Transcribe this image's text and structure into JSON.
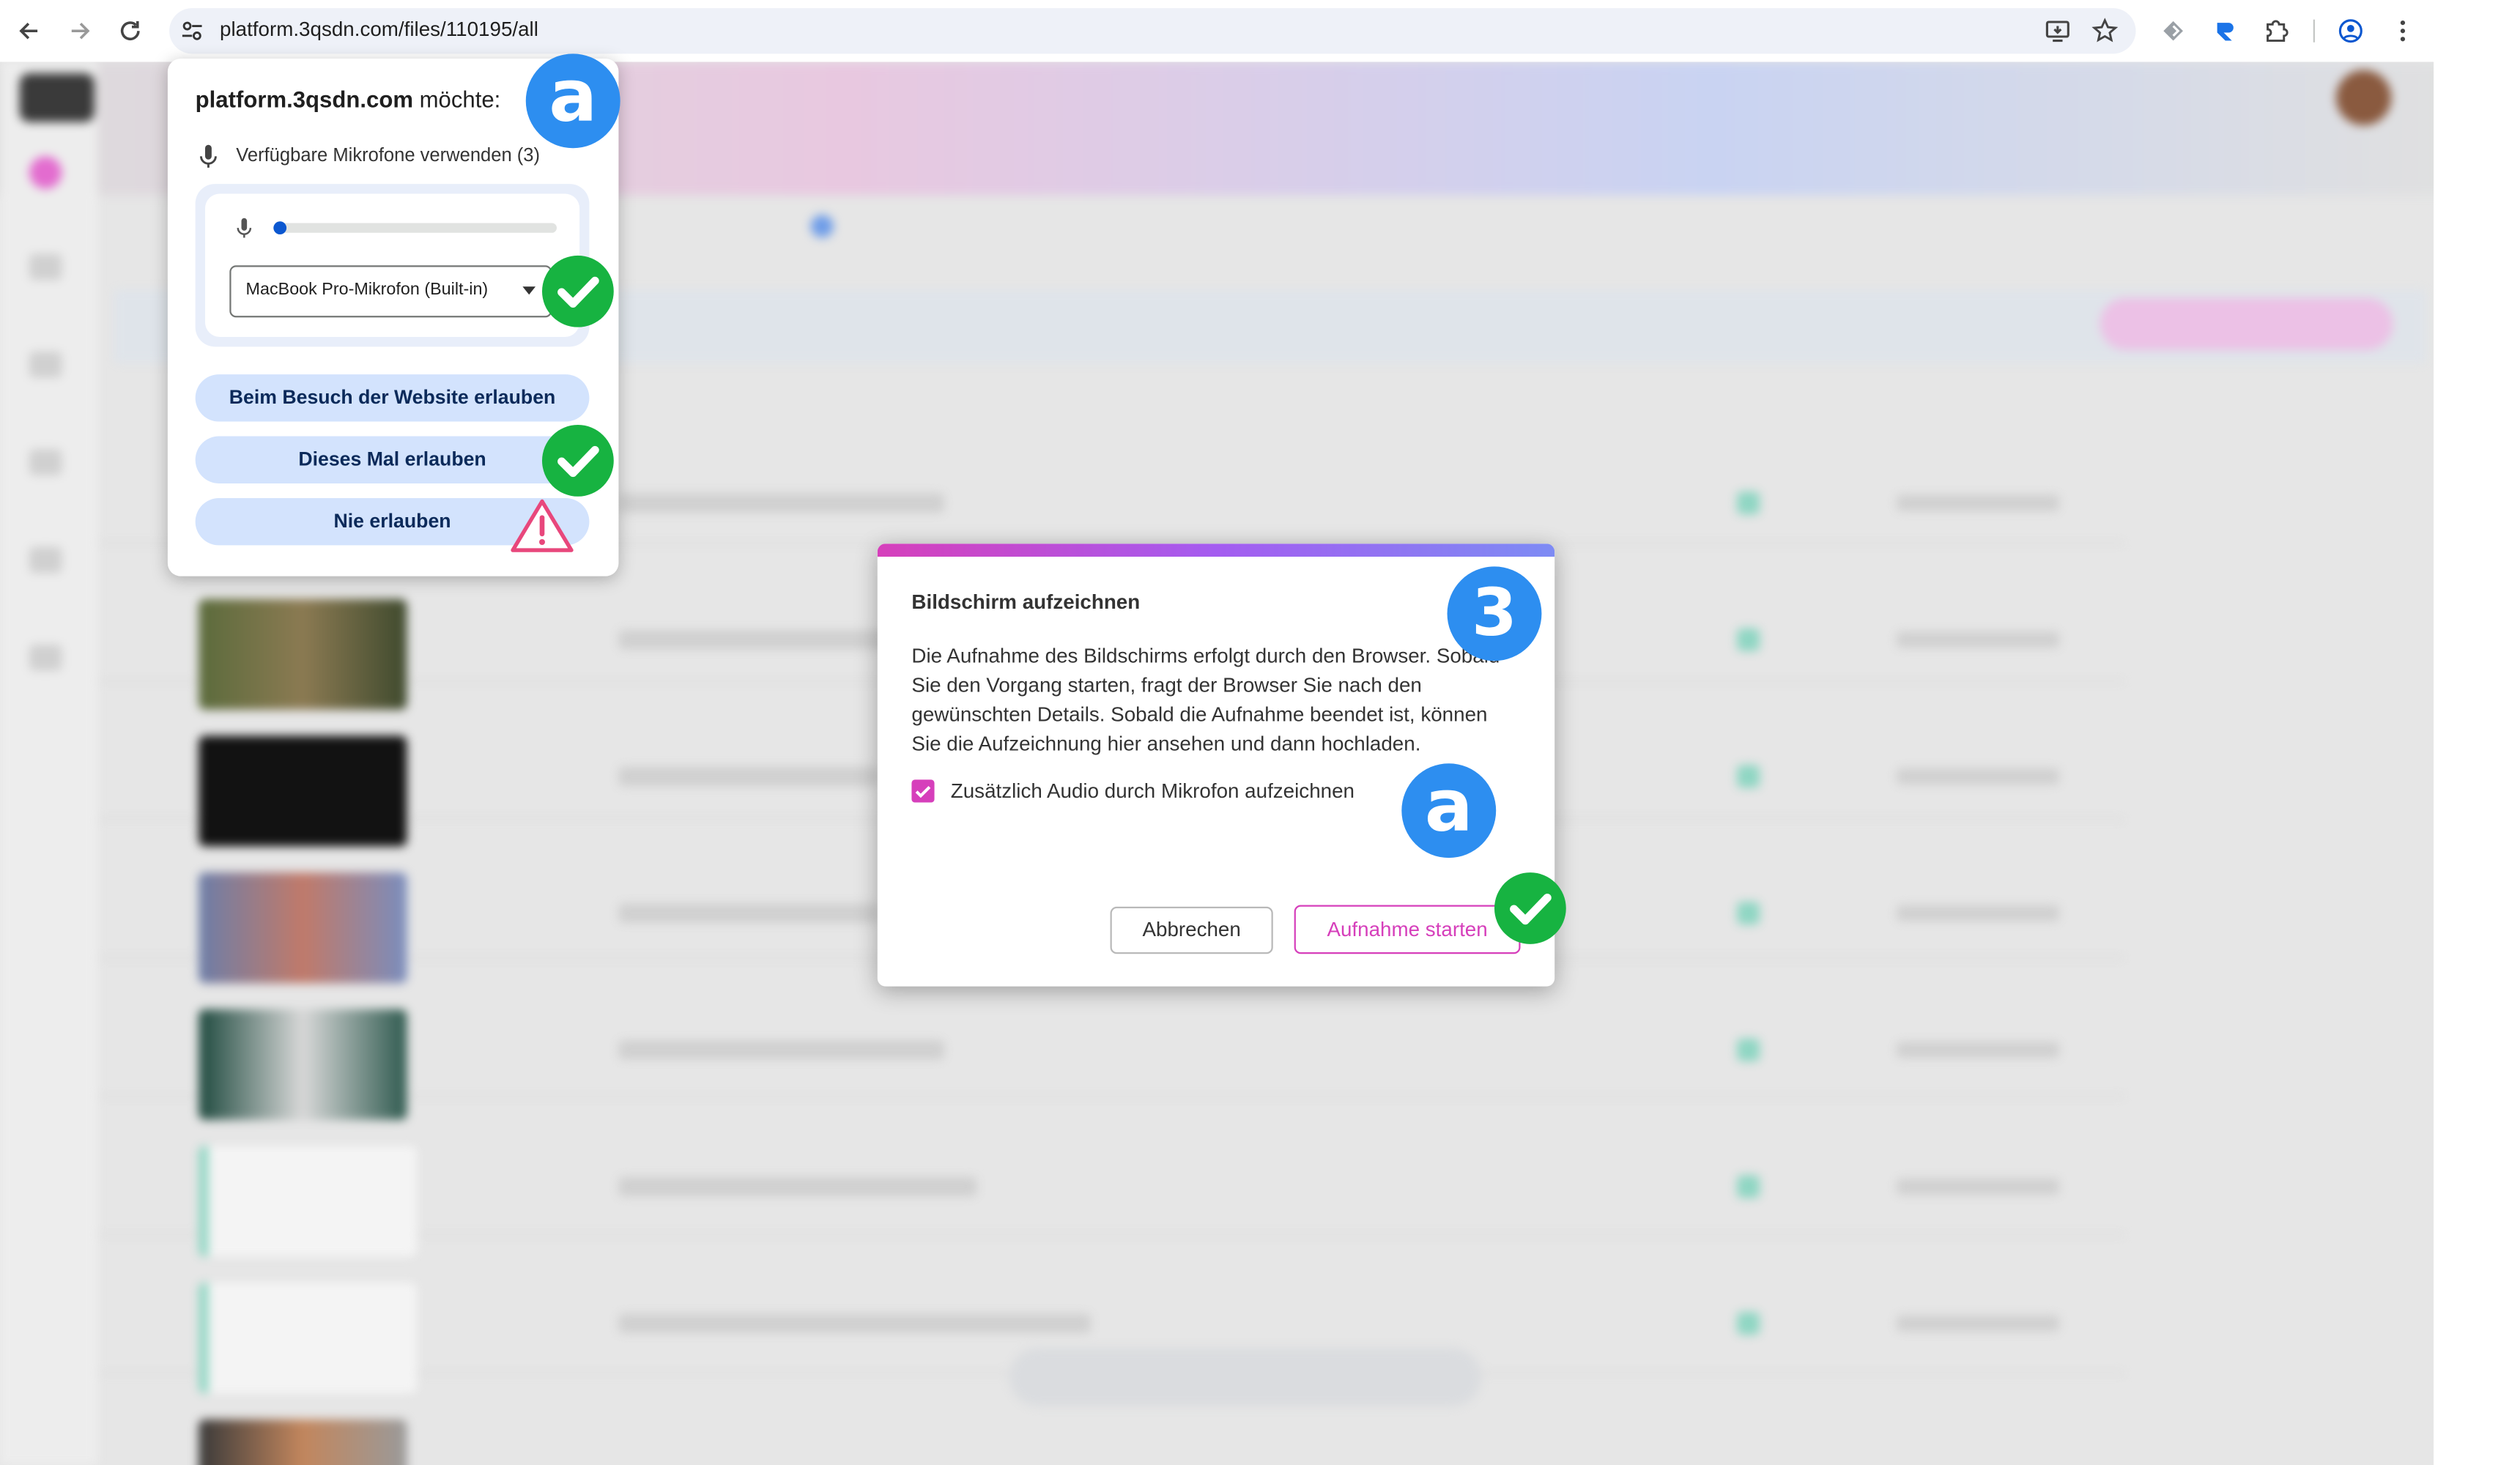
{
  "browser": {
    "url": "platform.3qsdn.com/files/110195/all"
  },
  "permission_popup": {
    "site": "platform.3qsdn.com",
    "verb": "möchte:",
    "mic_line": "Verfügbare Mikrofone verwenden (3)",
    "mic_level": 0.02,
    "mic_select": "MacBook Pro-Mikrofon (Built-in)",
    "buttons": [
      "Beim Besuch der Website erlauben",
      "Dieses Mal erlauben",
      "Nie erlauben"
    ]
  },
  "dialog": {
    "title": "Bildschirm aufzeichnen",
    "body": "Die Aufnahme des Bildschirms erfolgt durch den Browser. Sobald Sie den Vorgang starten, fragt der Browser Sie nach den gewünschten Details. Sobald die Aufnahme beendet ist, können Sie die Aufzeichnung hier ansehen und dann hochladen.",
    "checkbox_label": "Zusätzlich Audio durch Mikrofon aufzeichnen",
    "checkbox_checked": true,
    "cancel_label": "Abbrechen",
    "start_label": "Aufnahme starten"
  },
  "annotations": {
    "badge_a_top": "a",
    "badge_3": "3",
    "badge_a_dialog": "a"
  },
  "colors": {
    "accent": "#d63fbb",
    "chrome_blue": "#0b57d0",
    "badge_blue": "#2d8ef0",
    "check_green": "#17b341",
    "warning_pink": "#e8477c"
  }
}
